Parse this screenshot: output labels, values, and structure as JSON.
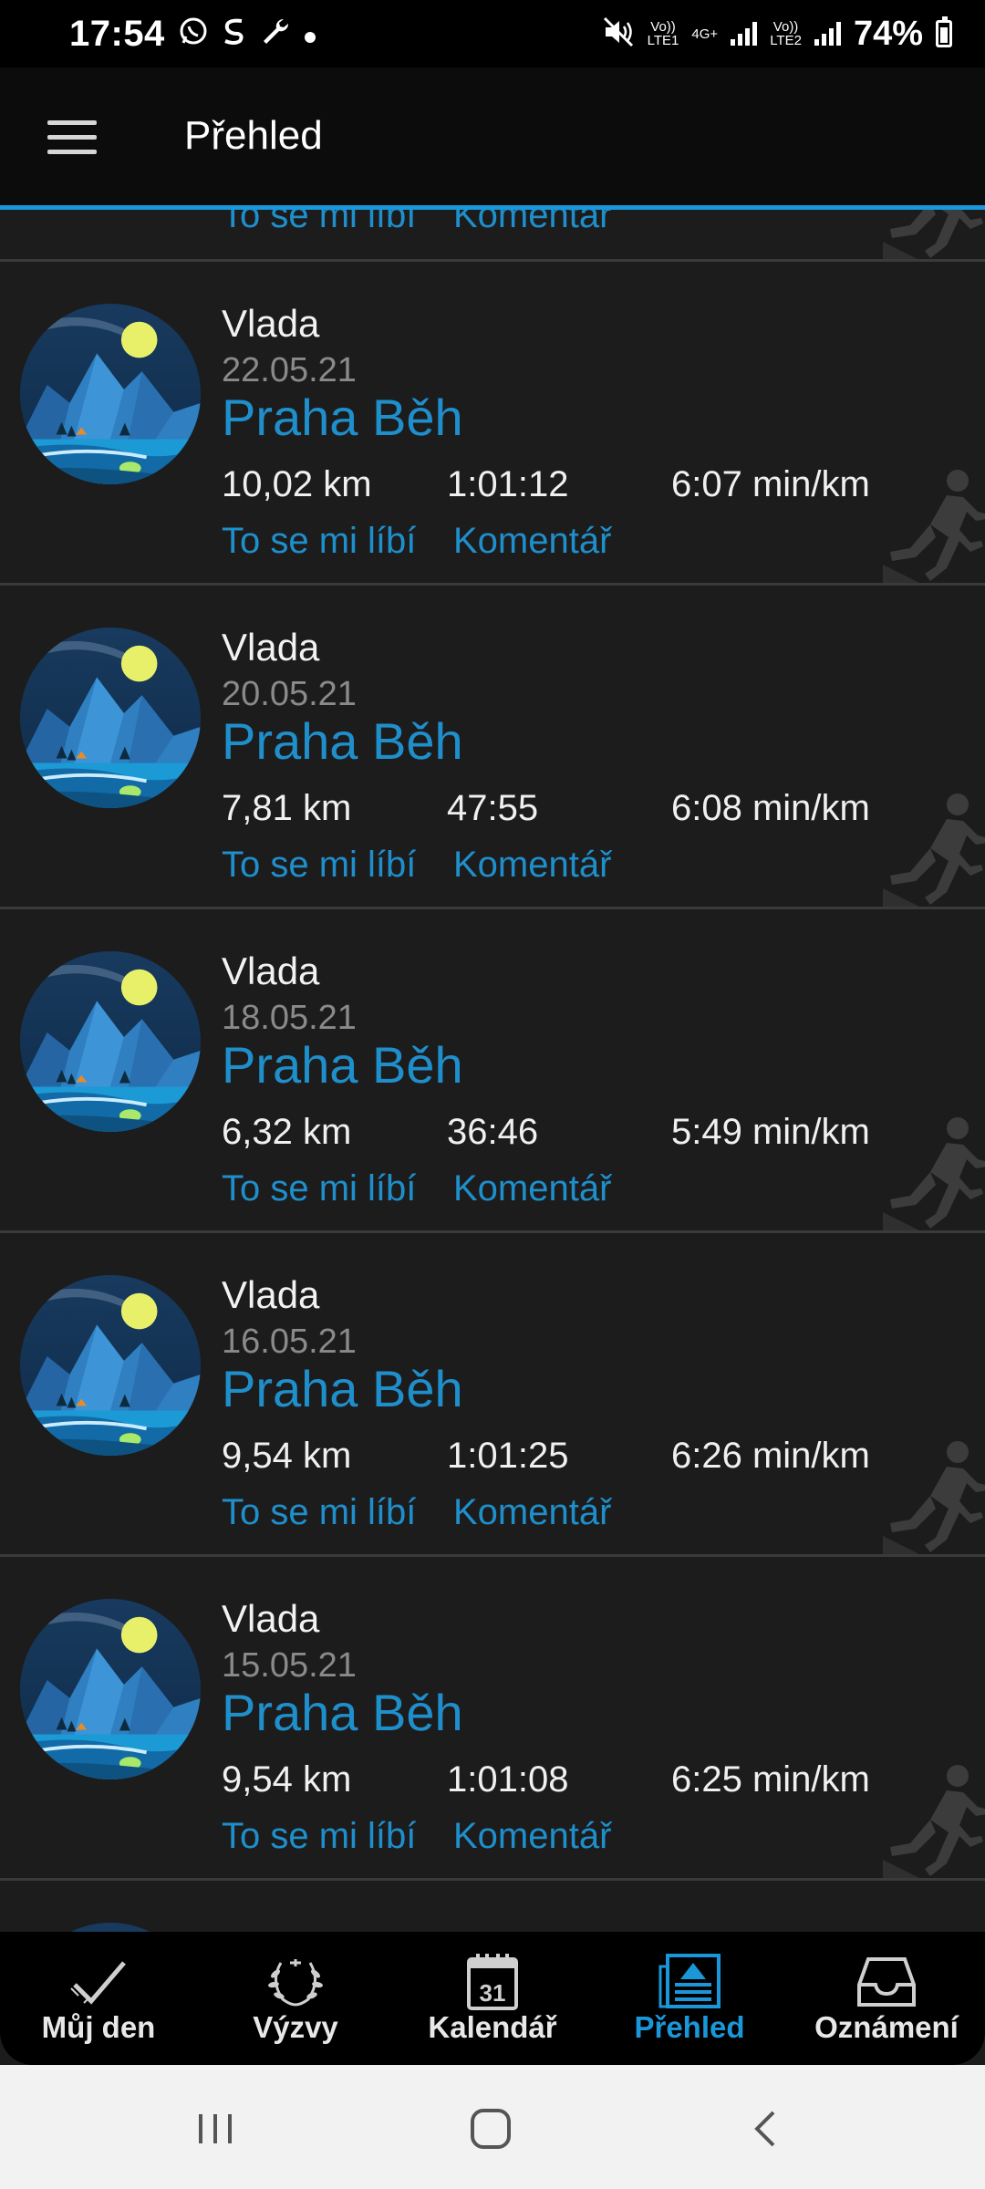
{
  "status_bar": {
    "time": "17:54",
    "sim1_label": "Vo))\nLTE1",
    "network_label": "4G+",
    "sim2_label": "Vo))\nLTE2",
    "battery": "74%"
  },
  "app_bar": {
    "title": "Přehled"
  },
  "colors": {
    "accent": "#1a97d9",
    "link": "#1f8fcb",
    "background": "#1c1c1d"
  },
  "partial_top_item": {
    "like_label": "To se mi líbí",
    "comment_label": "Komentář"
  },
  "feed": [
    {
      "name": "Vlada",
      "date": "22.05.21",
      "title": "Praha Běh",
      "distance": "10,02 km",
      "duration": "1:01:12",
      "pace": "6:07 min/km",
      "like_label": "To se mi líbí",
      "comment_label": "Komentář"
    },
    {
      "name": "Vlada",
      "date": "20.05.21",
      "title": "Praha Běh",
      "distance": "7,81 km",
      "duration": "47:55",
      "pace": "6:08 min/km",
      "like_label": "To se mi líbí",
      "comment_label": "Komentář"
    },
    {
      "name": "Vlada",
      "date": "18.05.21",
      "title": "Praha Běh",
      "distance": "6,32 km",
      "duration": "36:46",
      "pace": "5:49 min/km",
      "like_label": "To se mi líbí",
      "comment_label": "Komentář"
    },
    {
      "name": "Vlada",
      "date": "16.05.21",
      "title": "Praha Běh",
      "distance": "9,54 km",
      "duration": "1:01:25",
      "pace": "6:26 min/km",
      "like_label": "To se mi líbí",
      "comment_label": "Komentář"
    },
    {
      "name": "Vlada",
      "date": "15.05.21",
      "title": "Praha Běh",
      "distance": "9,54 km",
      "duration": "1:01:08",
      "pace": "6:25 min/km",
      "like_label": "To se mi líbí",
      "comment_label": "Komentář"
    }
  ],
  "bottom_nav": [
    {
      "label": "Můj den",
      "icon": "check-icon"
    },
    {
      "label": "Výzvy",
      "icon": "laurel-icon"
    },
    {
      "label": "Kalendář",
      "icon": "calendar-icon",
      "calendar_day": "31"
    },
    {
      "label": "Přehled",
      "icon": "newsfeed-icon",
      "active": true
    },
    {
      "label": "Oznámení",
      "icon": "inbox-icon"
    }
  ],
  "system_nav": [
    "recents-icon",
    "home-icon",
    "back-icon"
  ]
}
